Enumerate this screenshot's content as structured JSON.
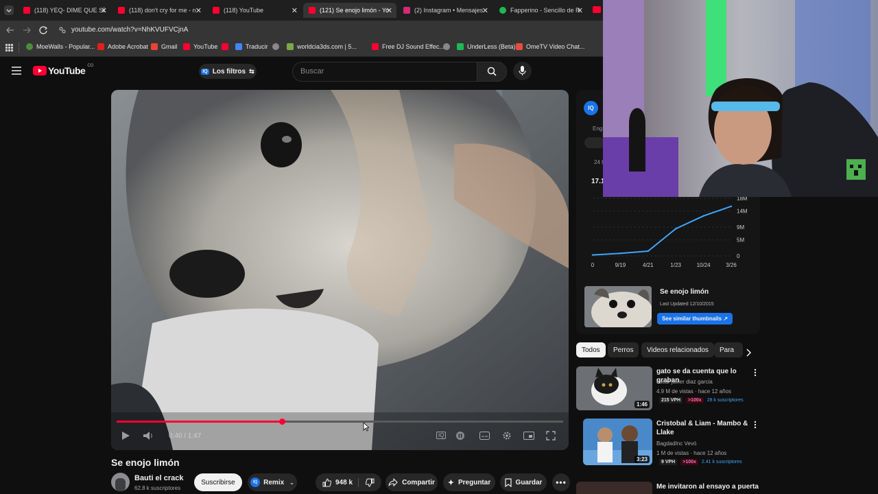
{
  "browser": {
    "tabs": [
      {
        "label": "(118) YEQ- DIME QUE SÍ",
        "color": "#ff0033"
      },
      {
        "label": "(118) don't cry for me - n",
        "color": "#ff0033"
      },
      {
        "label": "(118) YouTube",
        "color": "#ff0033"
      },
      {
        "label": "(121) Se enojo limón - Yo",
        "color": "#ff0033",
        "active": true
      },
      {
        "label": "(2) Instagram • Mensajes",
        "color": "#d62976"
      },
      {
        "label": "Fapperino - Sencillo de R",
        "color": "#1db954"
      }
    ],
    "url": "youtube.com/watch?v=NhKVUFVCjnA",
    "bookmarks": [
      "MoeWalls - Popular...",
      "Adobe Acrobat",
      "Gmail",
      "YouTube",
      "",
      "Traducir",
      "",
      "worldcia3ds.com | 5...",
      "Free DJ Sound Effec...",
      "",
      "UnderLess (Beta)",
      "OmeTV Video Chat..."
    ]
  },
  "header": {
    "logo_text": "YouTube",
    "logo_sup": "CO",
    "filters_label": "Los filtros",
    "search_placeholder": "Buscar"
  },
  "player": {
    "time": "0:40 / 1:47",
    "progress": 0.37
  },
  "video": {
    "title": "Se enojo limón",
    "channel": "Bauti el crack",
    "subs": "62.8 k suscriptores",
    "subscribe": "Suscribirse",
    "remix": "Remix",
    "likes": "948 k",
    "share": "Compartir",
    "ask": "Preguntar",
    "save": "Guardar"
  },
  "ext_panel": {
    "badge": "IQ",
    "lang": "Eng",
    "views_label": "24 h",
    "views": "17.1",
    "chart_ticks_y": [
      "18M",
      "14M",
      "9M",
      "5M",
      "0"
    ],
    "chart_ticks_x": [
      "0",
      "9/19",
      "4/21",
      "1/23",
      "10/24",
      "3/26"
    ],
    "thumb_title": "Se enojo limón",
    "thumb_updated": "Last Updated 12/10/2015",
    "thumb_btn": "See similar thumbnails ↗"
  },
  "chart_data": {
    "type": "line",
    "x": [
      "0",
      "9/19",
      "4/21",
      "1/23",
      "10/24",
      "3/26"
    ],
    "series": [
      {
        "values": [
          0.3,
          0.8,
          1.5,
          8.5,
          12.5,
          15.5
        ]
      }
    ],
    "ylim": [
      0,
      18
    ],
    "yticks": [
      "0",
      "5M",
      "9M",
      "14M",
      "18M"
    ]
  },
  "chips": [
    "Todos",
    "Perros",
    "Videos relacionados",
    "Para"
  ],
  "related": [
    {
      "title": "gato se da cuenta que lo graban",
      "channel": "oscar javier diaz garcia",
      "meta": "4.9 M de vistas · hace 12 años",
      "vph": "215 VPH",
      "mult": ">100x",
      "subs": "28 k suscriptores",
      "dur": "1:46"
    },
    {
      "title": "Cristobal & Liam - Mambo & Llake",
      "channel": "BagdadInc Vevó",
      "meta": "1 M de vistas · hace 12 años",
      "vph": "9 VPH",
      "mult": ">100x",
      "subs": "2.41 k suscriptores",
      "dur": "3:23"
    },
    {
      "title": "Me invitaron al ensayo a puerta",
      "channel": "",
      "meta": "",
      "vph": "",
      "mult": "",
      "subs": "",
      "dur": ""
    }
  ],
  "colors": {
    "accent": "#ff0033",
    "iq": "#1a73e8",
    "vph": "#ff6bd0",
    "mult_bg": "#3a0a0a",
    "subs": "#3ea6ff"
  }
}
